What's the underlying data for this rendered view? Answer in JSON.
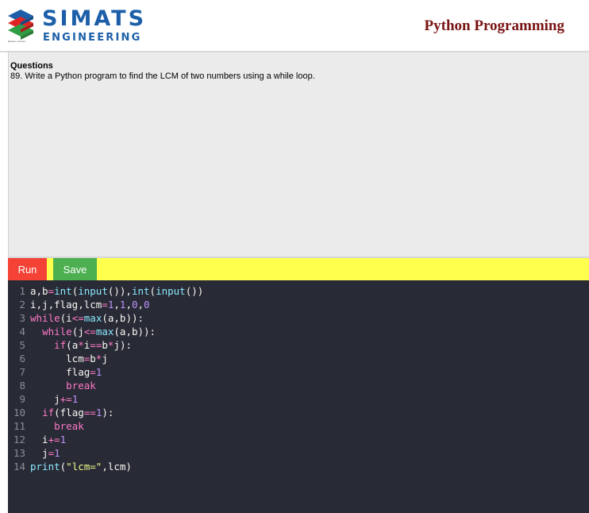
{
  "brand": {
    "logo_line1": "SIMATS",
    "logo_line2": "ENGINEERING",
    "logo_tagline": "Explore to Excel",
    "colors": {
      "logo_blue": "#1c5fa8",
      "logo_red": "#e02424",
      "logo_green": "#2e9e44"
    }
  },
  "header": {
    "course_title": "Python Programming"
  },
  "questions": {
    "label": "Questions",
    "text": "89. Write a Python program to find the LCM of two numbers using a while loop."
  },
  "toolbar": {
    "run_label": "Run",
    "save_label": "Save"
  },
  "editor": {
    "theme": "dracula",
    "lines": [
      {
        "no": "1",
        "text": "a,b=int(input()),int(input())"
      },
      {
        "no": "2",
        "text": "i,j,flag,lcm=1,1,0,0"
      },
      {
        "no": "3",
        "text": "while(i<=max(a,b)):"
      },
      {
        "no": "4",
        "text": "  while(j<=max(a,b)):"
      },
      {
        "no": "5",
        "text": "    if(a*i==b*j):"
      },
      {
        "no": "6",
        "text": "      lcm=b*j"
      },
      {
        "no": "7",
        "text": "      flag=1"
      },
      {
        "no": "8",
        "text": "      break"
      },
      {
        "no": "9",
        "text": "    j+=1"
      },
      {
        "no": "10",
        "text": "  if(flag==1):"
      },
      {
        "no": "11",
        "text": "    break"
      },
      {
        "no": "12",
        "text": "  i+=1"
      },
      {
        "no": "13",
        "text": "  j=1"
      },
      {
        "no": "14",
        "text": "print(\"lcm=\",lcm)"
      }
    ]
  }
}
